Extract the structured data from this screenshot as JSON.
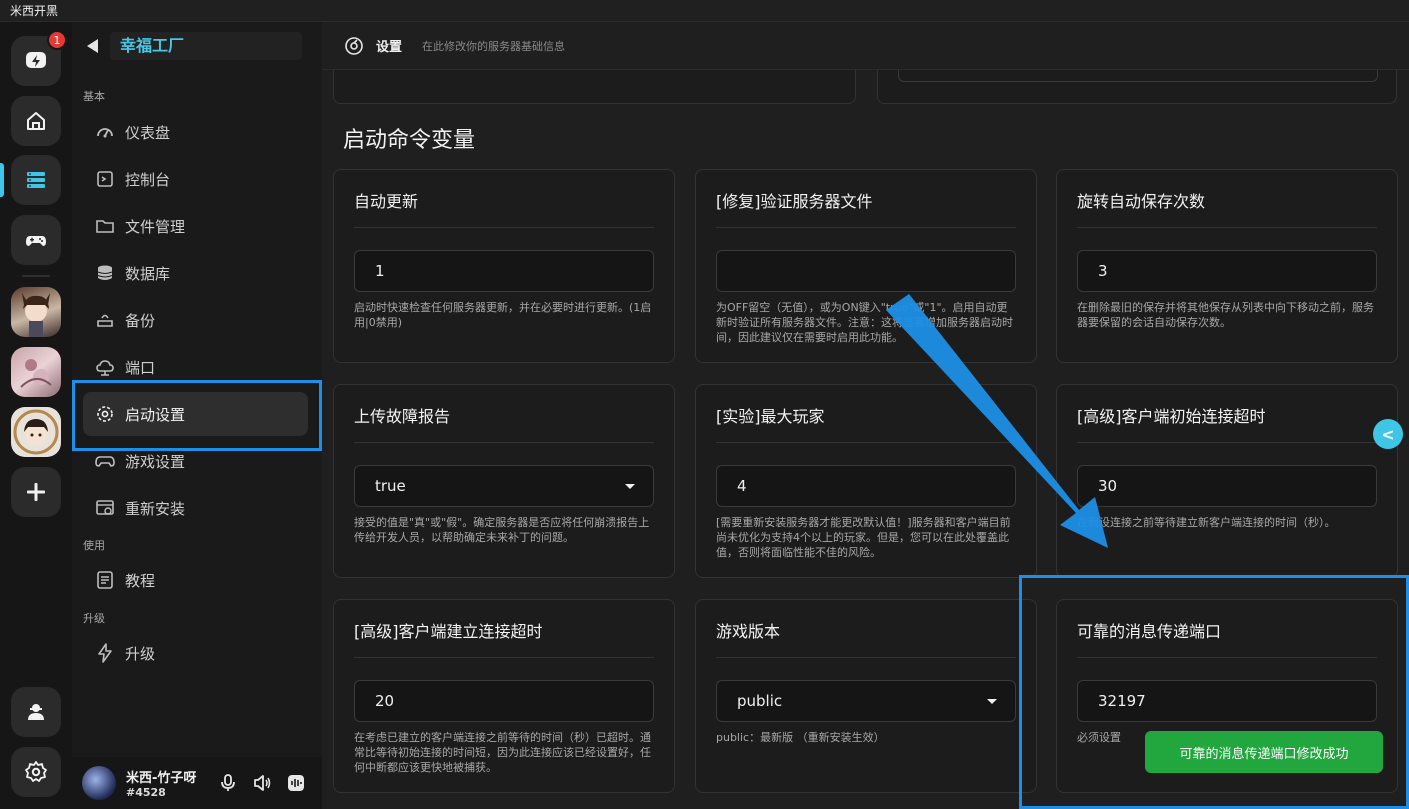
{
  "window": {
    "title": "米西开黑"
  },
  "rail": {
    "notification_count": "1"
  },
  "sidebar": {
    "server_name": "幸福工厂",
    "sections": {
      "basic": "基本",
      "use": "使用",
      "upgrade": "升级"
    },
    "items": [
      {
        "label": "仪表盘",
        "icon": "dashboard-icon"
      },
      {
        "label": "控制台",
        "icon": "console-icon"
      },
      {
        "label": "文件管理",
        "icon": "folder-icon"
      },
      {
        "label": "数据库",
        "icon": "database-icon"
      },
      {
        "label": "备份",
        "icon": "backup-icon"
      },
      {
        "label": "端口",
        "icon": "cloud-icon"
      },
      {
        "label": "启动设置",
        "icon": "gear-icon",
        "active": true
      },
      {
        "label": "游戏设置",
        "icon": "gamepad-icon"
      },
      {
        "label": "重新安装",
        "icon": "reinstall-icon"
      },
      {
        "label": "教程",
        "icon": "document-icon"
      },
      {
        "label": "升级",
        "icon": "bolt-icon"
      }
    ]
  },
  "user": {
    "name": "米西-竹子呀",
    "tag": "#4528"
  },
  "header": {
    "title": "设置",
    "subtitle": "在此修改你的服务器基础信息"
  },
  "main": {
    "section_title": "启动命令变量",
    "cards": [
      {
        "title": "自动更新",
        "value": "1",
        "type": "text",
        "desc": "启动时快速检查任何服务器更新，并在必要时进行更新。(1启用|0禁用)"
      },
      {
        "title": "[修复]验证服务器文件",
        "value": "",
        "type": "text",
        "desc": "为OFF留空（无值），或为ON键入\"true\"或\"1\"。启用自动更新时验证所有服务器文件。注意：这将显著增加服务器启动时间，因此建议仅在需要时启用此功能。"
      },
      {
        "title": "旋转自动保存次数",
        "value": "3",
        "type": "text",
        "desc": "在删除最旧的保存并将其他保存从列表中向下移动之前，服务器要保留的会话自动保存次数。"
      },
      {
        "title": "上传故障报告",
        "value": "true",
        "type": "select",
        "desc": "接受的值是\"真\"或\"假\"。确定服务器是否应将任何崩溃报告上传给开发人员，以帮助确定未来补丁的问题。"
      },
      {
        "title": "[实验]最大玩家",
        "value": "4",
        "type": "text",
        "desc": "[需要重新安装服务器才能更改默认值！]服务器和客户端目前尚未优化为支持4个以上的玩家。但是，您可以在此处覆盖此值，否则将面临性能不佳的风险。"
      },
      {
        "title": "[高级]客户端初始连接超时",
        "value": "30",
        "type": "text",
        "desc": "在假设连接之前等待建立新客户端连接的时间（秒）。"
      },
      {
        "title": "[高级]客户端建立连接超时",
        "value": "20",
        "type": "text",
        "desc": "在考虑已建立的客户端连接之前等待的时间（秒）已超时。通常比等待初始连接的时间短，因为此连接应该已经设置好，任何中断都应该更快地被捕获。"
      },
      {
        "title": "游戏版本",
        "value": "public",
        "type": "select",
        "desc": "public：最新版 （重新安装生效）"
      },
      {
        "title": "可靠的消息传递端口",
        "value": "32197",
        "type": "text",
        "desc": "必须设置"
      }
    ],
    "toast": "可靠的消息传递端口修改成功",
    "collapse_label": "<"
  },
  "colors": {
    "accent": "#3ec6e6",
    "highlight": "#1d8fe6",
    "success": "#22a73f",
    "badge": "#e53935"
  }
}
